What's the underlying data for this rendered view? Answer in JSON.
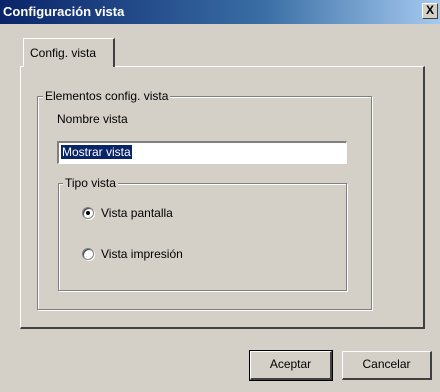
{
  "window": {
    "title": "Configuración vista",
    "close_label": "X"
  },
  "tabs": [
    {
      "label": "Config. vista",
      "selected": true
    }
  ],
  "group": {
    "legend": "Elementos config. vista",
    "name_label": "Nombre vista",
    "name_value": "Mostrar vista",
    "type_group": {
      "legend": "Tipo vista",
      "options": [
        {
          "label": "Vista pantalla",
          "selected": true
        },
        {
          "label": "Vista impresión",
          "selected": false
        }
      ]
    }
  },
  "buttons": {
    "accept": "Aceptar",
    "cancel": "Cancelar"
  }
}
